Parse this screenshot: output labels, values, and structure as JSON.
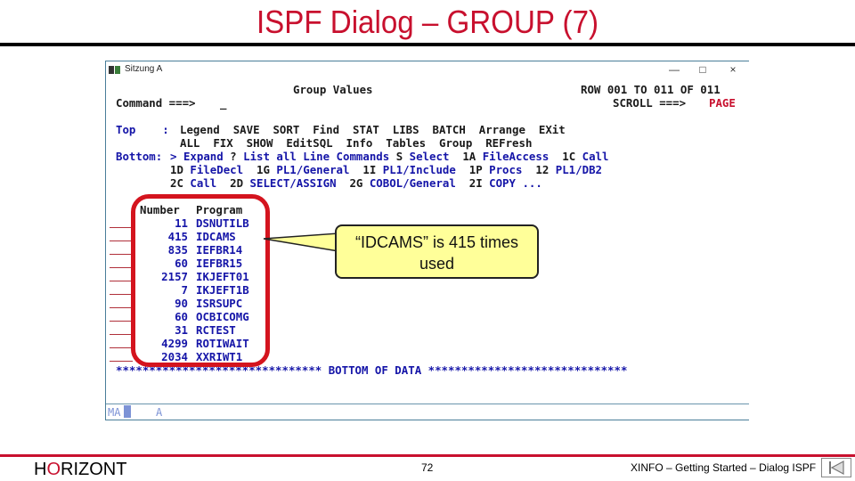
{
  "slide": {
    "title": "ISPF Dialog – GROUP (7)",
    "footer": {
      "logo_pre": "H",
      "logo_o": "O",
      "logo_post": "RIZONT",
      "page_number": "72",
      "caption": "XINFO – Getting Started – Dialog ISPF",
      "nav_icon": "first-page-icon"
    }
  },
  "window": {
    "title": "Sitzung A",
    "controls": {
      "minimize": "—",
      "maximize": "□",
      "close": "×"
    }
  },
  "screen": {
    "panel_title": "Group Values",
    "command_label": "Command ===>",
    "command_value": "_",
    "row_info": "ROW 001 TO 011 OF 011",
    "scroll_label": "SCROLL ===>",
    "scroll_value": "PAGE",
    "top_label": "Top    :",
    "top_commands_1": [
      "Legend",
      "SAVE",
      "SORT",
      "Find",
      "STAT",
      "LIBS",
      "BATCH",
      "Arrange",
      "EXit"
    ],
    "top_commands_2": [
      "ALL",
      "FIX",
      "SHOW",
      "EditSQL",
      "Info",
      "Tables",
      "Group",
      "REFresh"
    ],
    "bottom_label": "Bottom:",
    "line_commands": [
      {
        "code": ">",
        "label": "Expand"
      },
      {
        "code": "?",
        "label": "List all Line Commands"
      },
      {
        "code": "S",
        "label": "Select"
      },
      {
        "code": "1A",
        "label": "FileAccess"
      },
      {
        "code": "1C",
        "label": "Call"
      },
      {
        "code": "1D",
        "label": "FileDecl"
      },
      {
        "code": "1G",
        "label": "PL1/General"
      },
      {
        "code": "1I",
        "label": "PL1/Include"
      },
      {
        "code": "1P",
        "label": "Procs"
      },
      {
        "code": "12",
        "label": "PL1/DB2"
      },
      {
        "code": "2C",
        "label": "Call"
      },
      {
        "code": "2D",
        "label": "SELECT/ASSIGN"
      },
      {
        "code": "2G",
        "label": "COBOL/General"
      },
      {
        "code": "2I",
        "label": "COPY ..."
      }
    ],
    "table": {
      "headers": [
        "Number",
        "Program"
      ],
      "rows": [
        {
          "number": "11",
          "program": "DSNUTILB"
        },
        {
          "number": "415",
          "program": "IDCAMS"
        },
        {
          "number": "835",
          "program": "IEFBR14"
        },
        {
          "number": "60",
          "program": "IEFBR15"
        },
        {
          "number": "2157",
          "program": "IKJEFT01"
        },
        {
          "number": "7",
          "program": "IKJEFT1B"
        },
        {
          "number": "90",
          "program": "ISRSUPC"
        },
        {
          "number": "60",
          "program": "OCBICOMG"
        },
        {
          "number": "31",
          "program": "RCTEST"
        },
        {
          "number": "4299",
          "program": "ROTIWAIT"
        },
        {
          "number": "2034",
          "program": "XXRIWT1"
        }
      ]
    },
    "bottom_of_data": "******************************* BOTTOM OF DATA ******************************",
    "status_bar": {
      "mode": "MA",
      "indicator": "A"
    }
  },
  "callout": {
    "text": "“IDCAMS” is 415 times used"
  },
  "colors": {
    "accent_red": "#c8102e",
    "terminal_blue": "#1515a8",
    "callout_fill": "#ffff99"
  }
}
